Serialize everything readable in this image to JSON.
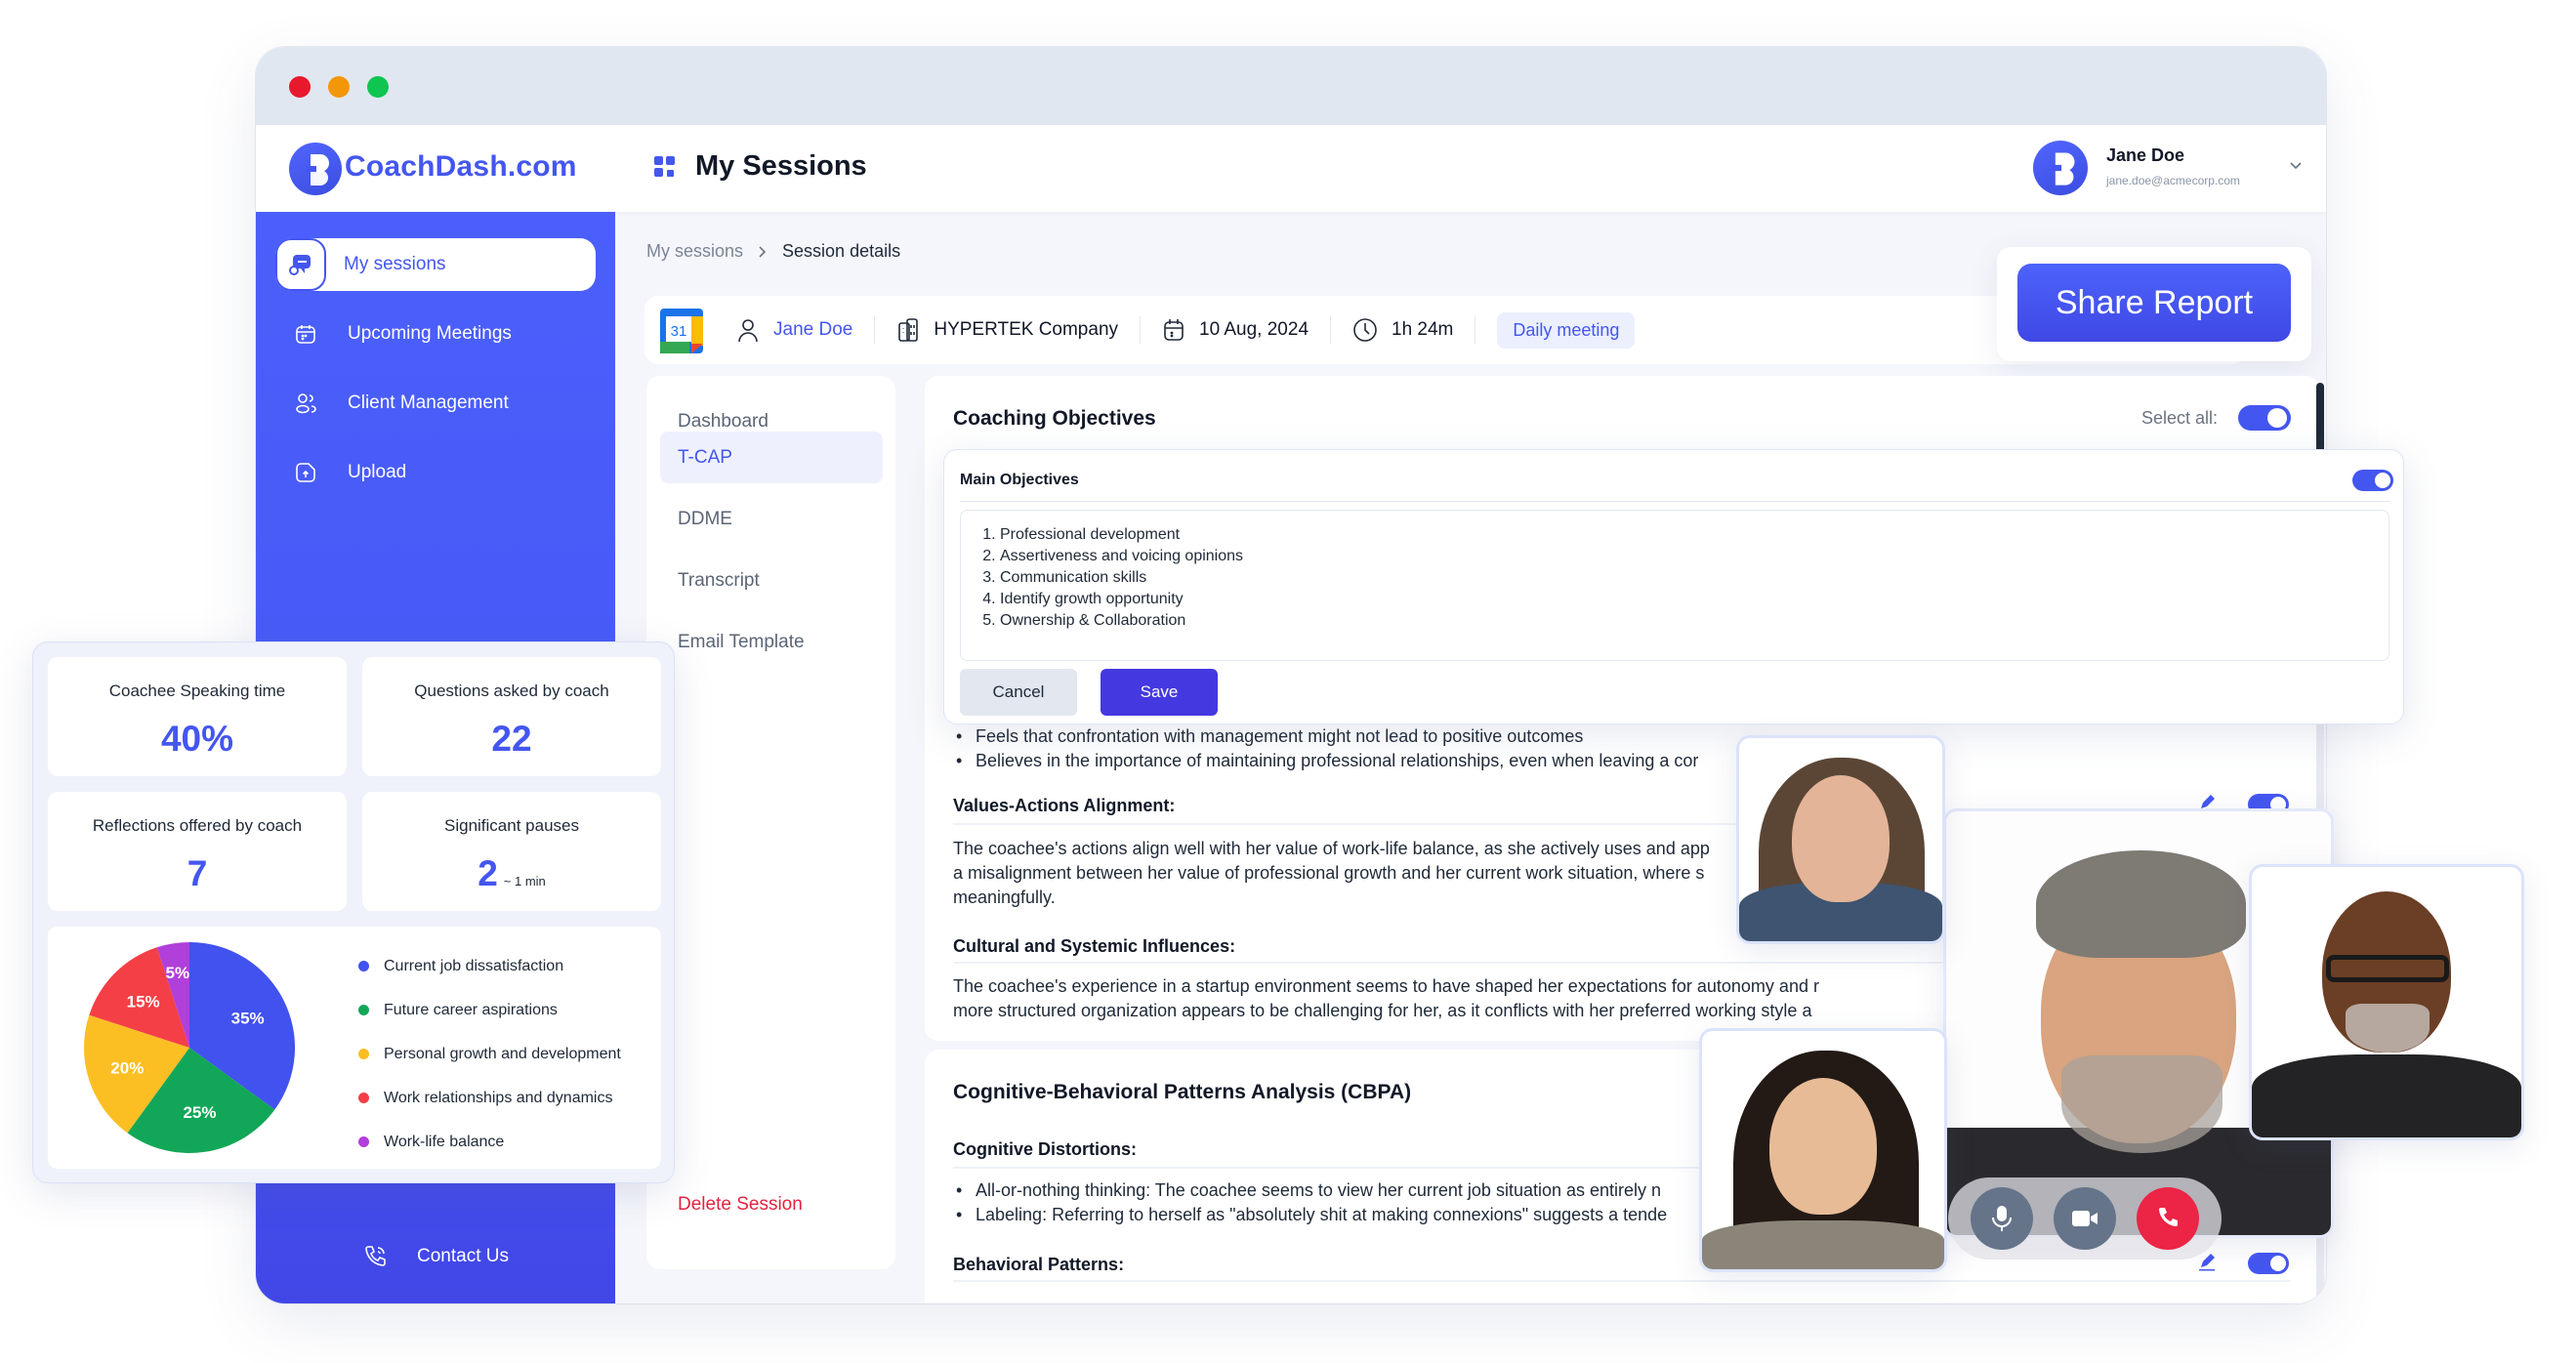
{
  "window": {
    "traffic_lights": [
      "#e8192c",
      "#f39708",
      "#0ec552"
    ]
  },
  "header": {
    "brand": "CoachDash.com",
    "page_title": "My Sessions",
    "user": {
      "name": "Jane Doe",
      "email": "jane.doe@acmecorp.com"
    }
  },
  "sidebar": {
    "items": [
      {
        "label": "My sessions",
        "icon": "chat-session-icon",
        "active": true
      },
      {
        "label": "Upcoming Meetings",
        "icon": "calendar-icon",
        "active": false
      },
      {
        "label": "Client Management",
        "icon": "users-icon",
        "active": false
      },
      {
        "label": "Upload",
        "icon": "upload-file-icon",
        "active": false
      }
    ],
    "contact_label": "Contact Us"
  },
  "breadcrumb": {
    "parent": "My sessions",
    "current": "Session details"
  },
  "session": {
    "client": "Jane Doe",
    "company": "HYPERTEK Company",
    "date": "10 Aug, 2024",
    "duration": "1h 24m",
    "type": "Daily meeting",
    "calendar_day": "31"
  },
  "share_button": "Share Report",
  "subnav": {
    "items": [
      "Dashboard",
      "T-CAP",
      "DDME",
      "Transcript",
      "Email Template"
    ],
    "active": "T-CAP",
    "delete_label": "Delete Session"
  },
  "content": {
    "coaching_objectives_title": "Coaching Objectives",
    "select_all_label": "Select all:",
    "select_all_on": true,
    "partial_bullets": [
      "Feels that confrontation with management might not lead to positive outcomes",
      "Believes in the importance of maintaining professional relationships, even when leaving a cor"
    ],
    "values_title": "Values-Actions Alignment:",
    "values_text": [
      "The coachee's actions align well with her value of work-life balance, as she actively uses and app",
      "a misalignment between her value of professional growth and her current work situation, where s",
      "meaningfully."
    ],
    "cultural_title": "Cultural and Systemic Influences:",
    "cultural_text": [
      "The coachee's experience in a startup environment seems to have shaped her expectations for autonomy and r",
      "more structured organization appears to be challenging for her, as it conflicts with her preferred working style a"
    ],
    "cbpa_title": "Cognitive-Behavioral Patterns Analysis (CBPA)",
    "distortions_title": "Cognitive Distortions:",
    "distortions": [
      "All-or-nothing thinking: The coachee seems to view her current job situation as entirely n",
      "Labeling: Referring to herself as \"absolutely shit at making connexions\" suggests a tende"
    ],
    "behavioral_title": "Behavioral Patterns:"
  },
  "objectives_editor": {
    "title": "Main Objectives",
    "enabled": true,
    "items": [
      "Professional development",
      "Assertiveness and voicing opinions",
      "Communication skills",
      "Identify growth opportunity",
      "Ownership & Collaboration"
    ],
    "cancel_label": "Cancel",
    "save_label": "Save"
  },
  "stats": [
    {
      "label": "Coachee Speaking time",
      "value": "40%",
      "suffix": ""
    },
    {
      "label": "Questions asked by coach",
      "value": "22",
      "suffix": ""
    },
    {
      "label": "Reflections offered by coach",
      "value": "7",
      "suffix": ""
    },
    {
      "label": "Significant pauses",
      "value": "2",
      "suffix": "~ 1 min"
    }
  ],
  "chart_data": {
    "type": "pie",
    "title": "",
    "categories": [
      "Current job dissatisfaction",
      "Future career aspirations",
      "Personal growth and development",
      "Work relationships and dynamics",
      "Work-life balance"
    ],
    "values": [
      35,
      25,
      20,
      15,
      5
    ],
    "labels": [
      "35%",
      "25%",
      "20%",
      "15%",
      "5%"
    ],
    "colors": [
      "#4152ee",
      "#12a758",
      "#fbbf24",
      "#f43f46",
      "#b13fd9"
    ],
    "legend": "right"
  },
  "video_call": {
    "participants": [
      "participant-woman-1",
      "participant-man-main",
      "participant-man-2",
      "participant-woman-2"
    ],
    "controls": [
      "microphone",
      "camera",
      "end-call"
    ]
  }
}
